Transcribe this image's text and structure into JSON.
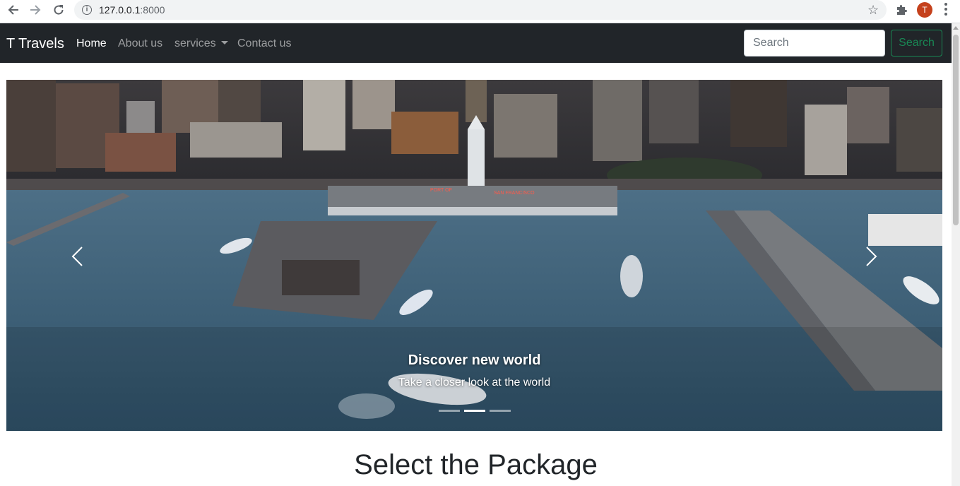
{
  "browser": {
    "url_host": "127.0.0.1",
    "url_port": ":8000",
    "avatar_letter": "T"
  },
  "navbar": {
    "brand": "T Travels",
    "links": [
      {
        "label": "Home",
        "active": true
      },
      {
        "label": "About us",
        "active": false
      },
      {
        "label": "services",
        "active": false,
        "dropdown": true
      },
      {
        "label": "Contact us",
        "active": false
      }
    ],
    "search_placeholder": "Search",
    "search_button": "Search"
  },
  "carousel": {
    "caption_title": "Discover new world",
    "caption_text": "Take a closer look at the world",
    "slide_count": 3,
    "active_slide": 2,
    "sign_text_1": "PORT OF",
    "sign_text_2": "SAN FRANCISCO"
  },
  "main": {
    "section_title": "Select the Package"
  },
  "colors": {
    "navbar_bg": "#212529",
    "success": "#198754",
    "avatar": "#c5411c"
  }
}
